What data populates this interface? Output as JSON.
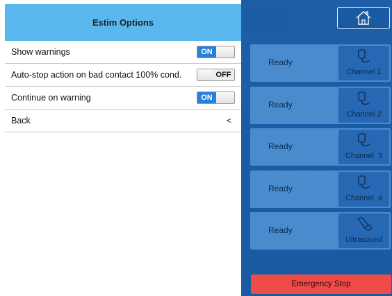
{
  "header": {
    "title": "Estim Options"
  },
  "options": [
    {
      "label": "Show warnings",
      "state": "ON"
    },
    {
      "label": "Auto-stop action on bad contact 100% cond.",
      "state": "OFF"
    },
    {
      "label": "Continue on warning",
      "state": "ON"
    }
  ],
  "back": {
    "label": "Back",
    "chevron": "<"
  },
  "channels": [
    {
      "status": "Ready",
      "label": "Channel 1",
      "icon": "electrode-icon"
    },
    {
      "status": "Ready",
      "label": "Channel 2",
      "icon": "electrode-icon"
    },
    {
      "status": "Ready",
      "label": "Channel  3",
      "icon": "electrode-icon"
    },
    {
      "status": "Ready",
      "label": "Channel  4",
      "icon": "electrode-icon"
    },
    {
      "status": "Ready",
      "label": "Ultrasound",
      "icon": "ultrasound-probe-icon"
    }
  ],
  "emergency_stop": {
    "label": "Emergency Stop"
  },
  "home": {
    "icon": "home-icon"
  },
  "colors": {
    "header": "#5ab8ee",
    "panel": "#1c5ea8",
    "card": "#4a8bce",
    "toggle_on": "#2a7fd8",
    "stop": "#ef4b48"
  }
}
